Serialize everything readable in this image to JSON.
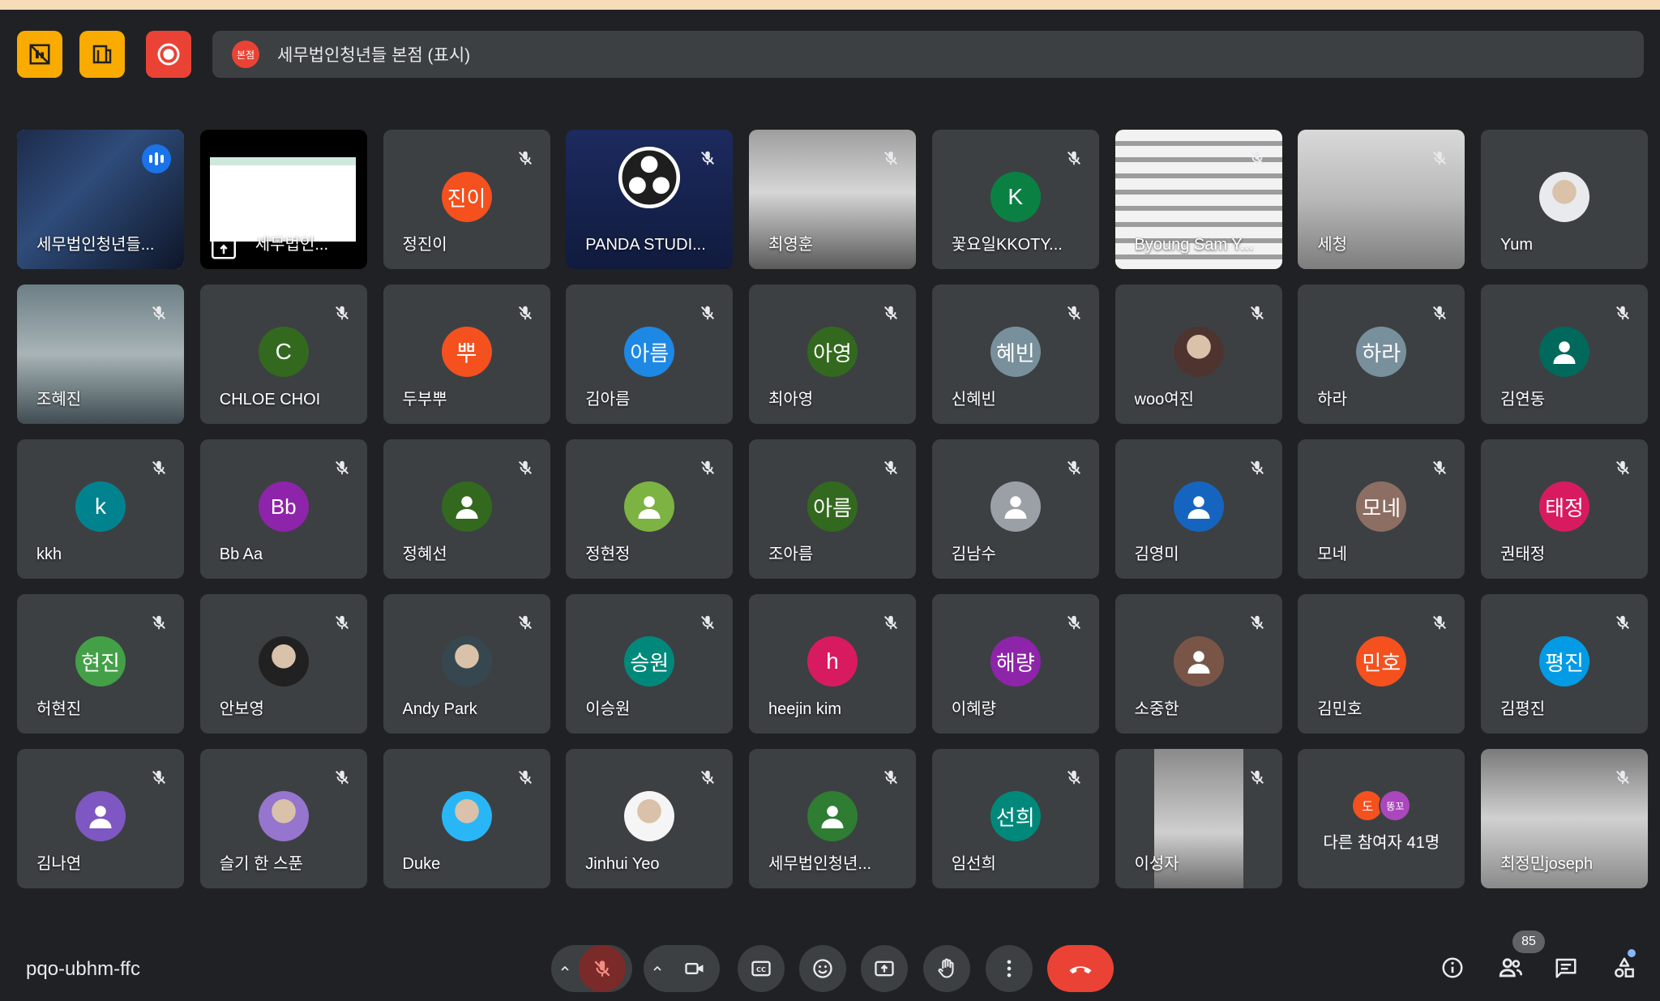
{
  "banner": {
    "badge": "본점",
    "title": "세무법인청년들 본점 (표시)"
  },
  "colors": {
    "active_border": "#8ab4f8",
    "tile_bg": "#3c4043",
    "end_call": "#ea4335",
    "accent_yellow": "#f9ab00"
  },
  "tiles": [
    {
      "name": "세무법인청년들...",
      "type": "video",
      "speaking": true
    },
    {
      "name": "세무법인...",
      "type": "screen"
    },
    {
      "name": "정진이",
      "initials": "진이",
      "color": "#f4511e"
    },
    {
      "name": "PANDA STUDI...",
      "type": "obs"
    },
    {
      "name": "최영훈",
      "type": "video"
    },
    {
      "name": "꽃요일KKOTY...",
      "initials": "K",
      "color": "#0b8043"
    },
    {
      "name": "Byoung Sam Y...",
      "type": "video"
    },
    {
      "name": "세청",
      "type": "video"
    },
    {
      "name": "Yum",
      "type": "photo",
      "color": "#e8eaed"
    },
    {
      "name": "조혜진",
      "type": "photo",
      "color": "#607d8b"
    },
    {
      "name": "CHLOE CHOI",
      "initials": "C",
      "color": "#33691e"
    },
    {
      "name": "두부뿌",
      "initials": "뿌",
      "color": "#f4511e"
    },
    {
      "name": "김아름",
      "initials": "아름",
      "color": "#1e88e5"
    },
    {
      "name": "최아영",
      "initials": "아영",
      "color": "#33691e"
    },
    {
      "name": "신혜빈",
      "initials": "혜빈",
      "color": "#78909c"
    },
    {
      "name": "woo여진",
      "type": "photo",
      "color": "#4e342e"
    },
    {
      "name": "하라",
      "initials": "하라",
      "color": "#78909c"
    },
    {
      "name": "김연동",
      "type": "person",
      "color": "#00695c"
    },
    {
      "name": "kkh",
      "initials": "k",
      "color": "#00838f"
    },
    {
      "name": "Bb Aa",
      "initials": "Bb",
      "color": "#8e24aa"
    },
    {
      "name": "정혜선",
      "type": "person",
      "color": "#33691e"
    },
    {
      "name": "정현정",
      "type": "person",
      "color": "#7cb342"
    },
    {
      "name": "조아름",
      "initials": "아름",
      "color": "#33691e"
    },
    {
      "name": "김남수",
      "type": "person",
      "color": "#9aa0a6"
    },
    {
      "name": "김영미",
      "type": "person",
      "color": "#1565c0"
    },
    {
      "name": "모네",
      "initials": "모네",
      "color": "#8d6e63"
    },
    {
      "name": "권태정",
      "initials": "태정",
      "color": "#d81b60"
    },
    {
      "name": "허현진",
      "initials": "현진",
      "color": "#43a047"
    },
    {
      "name": "안보영",
      "type": "photo",
      "color": "#212121"
    },
    {
      "name": "Andy Park",
      "type": "photo",
      "color": "#37474f"
    },
    {
      "name": "이승원",
      "initials": "승원",
      "color": "#00897b"
    },
    {
      "name": "heejin kim",
      "initials": "h",
      "color": "#d81b60"
    },
    {
      "name": "이혜량",
      "initials": "해량",
      "color": "#8e24aa"
    },
    {
      "name": "소중한",
      "type": "person",
      "color": "#795548"
    },
    {
      "name": "김민호",
      "initials": "민호",
      "color": "#f4511e"
    },
    {
      "name": "김평진",
      "initials": "평진",
      "color": "#039be5"
    },
    {
      "name": "김나연",
      "type": "person",
      "color": "#7e57c2"
    },
    {
      "name": "슬기 한 스푼",
      "type": "photo",
      "color": "#9575cd"
    },
    {
      "name": "Duke",
      "type": "photo",
      "color": "#29b6f6"
    },
    {
      "name": "Jinhui Yeo",
      "type": "photo",
      "color": "#f5f5f5"
    },
    {
      "name": "세무법인청년...",
      "type": "person",
      "color": "#2e7d32"
    },
    {
      "name": "임선희",
      "initials": "선희",
      "color": "#00897b"
    },
    {
      "name": "이성자",
      "type": "video"
    },
    {
      "name": "다른 참여자 41명",
      "type": "others"
    },
    {
      "name": "최정민joseph",
      "type": "video"
    }
  ],
  "others": {
    "label": "다른 참여자 41명",
    "mini": [
      {
        "initial": "도",
        "color": "#f4511e"
      },
      {
        "initial": "똥꼬",
        "color": "#ab47bc"
      }
    ]
  },
  "bottom": {
    "meeting_code": "pqo-ubhm-ffc",
    "participants_count": "85"
  }
}
